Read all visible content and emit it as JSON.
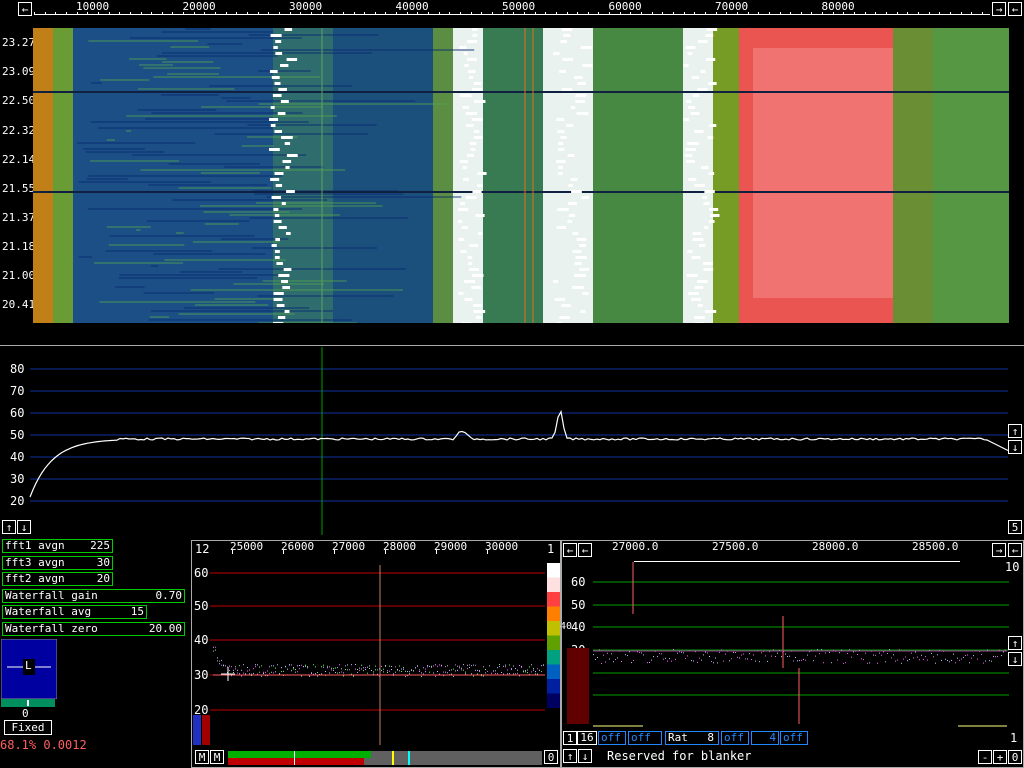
{
  "waterfall": {
    "freq_labels": [
      "10000",
      "20000",
      "30000",
      "40000",
      "50000",
      "60000",
      "70000",
      "80000"
    ],
    "time_labels": [
      "23.27",
      "23.09",
      "22.50",
      "22.32",
      "22.14",
      "21.55",
      "21.37",
      "21.18",
      "21.00",
      "20.41"
    ]
  },
  "spectrum": {
    "y_labels": [
      "80",
      "70",
      "60",
      "50",
      "40",
      "30",
      "20"
    ],
    "right_button": "5"
  },
  "params": [
    {
      "label": "fft1 avgn",
      "value": "225"
    },
    {
      "label": "fft3 avgn",
      "value": "30"
    },
    {
      "label": "fft2 avgn",
      "value": "20"
    },
    {
      "label": "Waterfall gain",
      "value": "0.70"
    },
    {
      "label": "Waterfall avg",
      "value": "15"
    },
    {
      "label": "Waterfall zero",
      "value": "20.00"
    }
  ],
  "smeter": {
    "letter": "L",
    "value": "0",
    "mode": "Fixed",
    "status": "68.1% 0.0012"
  },
  "baseband": {
    "left_num": "12",
    "right_num": "1",
    "freq_labels": [
      "25000",
      "26000",
      "27000",
      "28000",
      "29000",
      "30000"
    ],
    "y_labels": [
      "60",
      "50",
      "40",
      "30",
      "20"
    ],
    "colorbar_label": "40",
    "m1": "M",
    "m2": "M",
    "zero": "0"
  },
  "hires": {
    "freq_labels": [
      "27000.0",
      "27500.0",
      "28000.0",
      "28500.0"
    ],
    "y_labels": [
      "60",
      "50",
      "40",
      "30",
      "20",
      "10"
    ],
    "top_right": "10",
    "bottom_right": "1"
  },
  "blanker": {
    "box1": "1",
    "box2": "16",
    "off1": "off",
    "off2": "off",
    "rat_label": "Rat",
    "rat_value": "8",
    "off3": "off",
    "box4": "4",
    "off4": "off",
    "message": "Reserved for blanker",
    "minus": "-",
    "plus": "+",
    "zero": "0"
  },
  "colors": {
    "accent_red": "#ff6060",
    "grid_blue": "#1030a0",
    "grid_green": "#00a000"
  }
}
